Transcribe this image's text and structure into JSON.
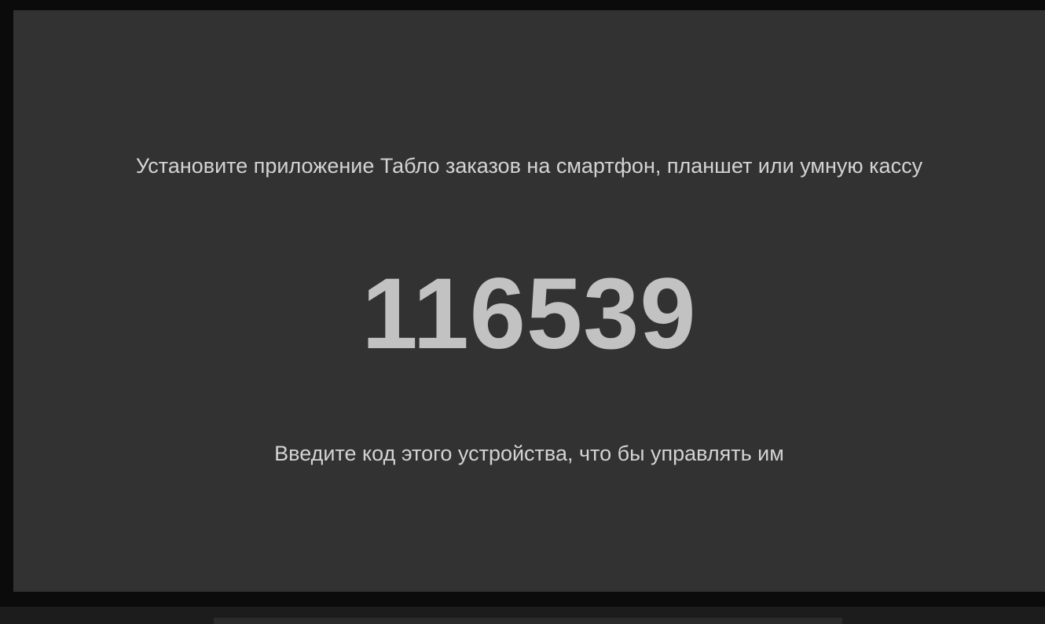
{
  "screen": {
    "instruction": "Установите приложение Табло заказов на смартфон, планшет или умную кассу",
    "device_code": "116539",
    "hint": "Введите код этого устройства, что бы управлять им"
  },
  "colors": {
    "background": "#323232",
    "frame": "#0b0b0b",
    "text": "#d3d3d3",
    "code_text": "#c2c2c2"
  }
}
